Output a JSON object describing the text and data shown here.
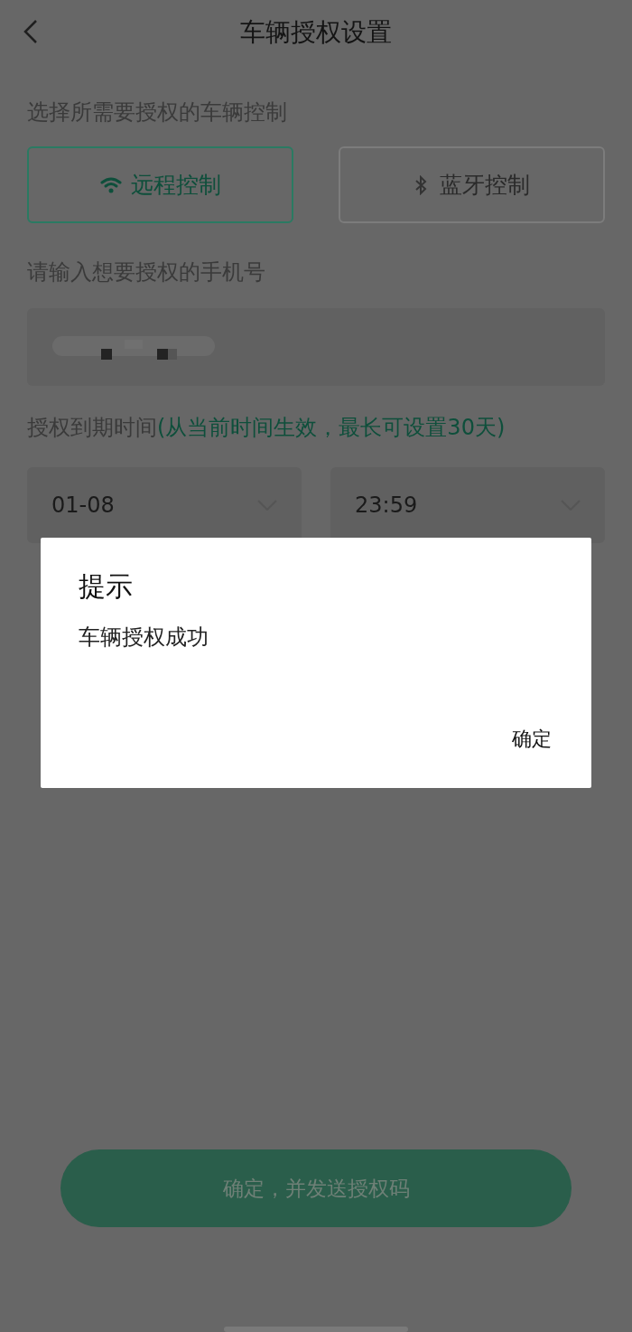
{
  "header": {
    "title": "车辆授权设置"
  },
  "control_section": {
    "label": "选择所需要授权的车辆控制",
    "options": [
      {
        "label": "远程控制",
        "selected": true
      },
      {
        "label": "蓝牙控制",
        "selected": false
      }
    ]
  },
  "phone_section": {
    "label": "请输入想要授权的手机号"
  },
  "expiry_section": {
    "label": "授权到期时间",
    "note": "(从当前时间生效，最长可设置30天)",
    "date": "01-08",
    "time": "23:59"
  },
  "submit_button": {
    "label": "确定，并发送授权码"
  },
  "dialog": {
    "title": "提示",
    "message": "车辆授权成功",
    "confirm": "确定"
  }
}
